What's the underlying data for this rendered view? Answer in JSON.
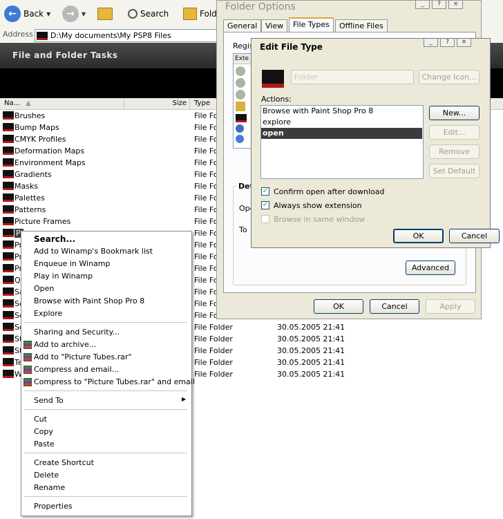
{
  "toolbar": {
    "back_label": "Back",
    "search_label": "Search",
    "folders_label": "Fold"
  },
  "address": {
    "label": "Address",
    "path": "D:\\My documents\\My PSP8 Files"
  },
  "tasks_panel": {
    "title": "File and Folder Tasks"
  },
  "columns": {
    "name": "Na...",
    "size": "Size",
    "type": "Type"
  },
  "files": [
    {
      "name": "Brushes",
      "type": "File Fo",
      "date": ""
    },
    {
      "name": "Bump Maps",
      "type": "File Fo",
      "date": ""
    },
    {
      "name": "CMYK Profiles",
      "type": "File Fo",
      "date": ""
    },
    {
      "name": "Deformation Maps",
      "type": "File Fo",
      "date": ""
    },
    {
      "name": "Environment Maps",
      "type": "File Fo",
      "date": ""
    },
    {
      "name": "Gradients",
      "type": "File Fo",
      "date": ""
    },
    {
      "name": "Masks",
      "type": "File Fo",
      "date": ""
    },
    {
      "name": "Palettes",
      "type": "File Fo",
      "date": ""
    },
    {
      "name": "Patterns",
      "type": "File Fo",
      "date": ""
    },
    {
      "name": "Picture Frames",
      "type": "File Fo",
      "date": ""
    },
    {
      "name": "Pi",
      "type": "File Fo",
      "date": ""
    },
    {
      "name": "Pr",
      "type": "File Fo",
      "date": ""
    },
    {
      "name": "Pr",
      "type": "File Fo",
      "date": ""
    },
    {
      "name": "Pr",
      "type": "File Fo",
      "date": ""
    },
    {
      "name": "Q",
      "type": "File Fo",
      "date": ""
    },
    {
      "name": "Sa",
      "type": "File Fo",
      "date": ""
    },
    {
      "name": "Sc",
      "type": "File Fo",
      "date": ""
    },
    {
      "name": "Sc",
      "type": "File Fo",
      "date": ""
    },
    {
      "name": "Sc",
      "type": "File Folder",
      "date": "30.05.2005 21:41"
    },
    {
      "name": "St",
      "type": "File Folder",
      "date": "30.05.2005 21:41"
    },
    {
      "name": "St",
      "type": "File Folder",
      "date": "30.05.2005 21:41"
    },
    {
      "name": "Te",
      "type": "File Folder",
      "date": "30.05.2005 21:41"
    },
    {
      "name": "W",
      "type": "File Folder",
      "date": "30.05.2005 21:41"
    }
  ],
  "context_menu": {
    "search": "Search...",
    "winamp_bookmark": "Add to Winamp's Bookmark list",
    "enqueue": "Enqueue in Winamp",
    "play": "Play in Winamp",
    "open": "Open",
    "browse_psp": "Browse with Paint Shop Pro 8",
    "explore": "Explore",
    "sharing": "Sharing and Security...",
    "add_archive": "Add to archive...",
    "add_rar": "Add to \"Picture Tubes.rar\"",
    "compress_email": "Compress and email...",
    "compress_rar_email": "Compress to \"Picture Tubes.rar\" and email",
    "send_to": "Send To",
    "cut": "Cut",
    "copy": "Copy",
    "paste": "Paste",
    "create_shortcut": "Create Shortcut",
    "delete": "Delete",
    "rename": "Rename",
    "properties": "Properties"
  },
  "folder_options": {
    "title": "Folder Options",
    "tabs": [
      "General",
      "View",
      "File Types",
      "Offline Files"
    ],
    "registered_label": "Regis",
    "ext_header": "Exte",
    "details_label": "Det",
    "opens_label": "Ope",
    "to_label": "To",
    "advanced": "Advanced",
    "ok": "OK",
    "cancel": "Cancel",
    "apply": "Apply"
  },
  "edit_file_type": {
    "title": "Edit File Type",
    "type_name": "Folder",
    "change_icon": "Change Icon...",
    "actions_label": "Actions:",
    "actions": [
      "Browse with Paint Shop Pro 8",
      "explore",
      "open"
    ],
    "new": "New...",
    "edit": "Edit...",
    "remove": "Remove",
    "set_default": "Set Default",
    "confirm_open": "Confirm open after download",
    "always_show_ext": "Always show extension",
    "browse_same_window": "Browse in same window",
    "ok": "OK",
    "cancel": "Cancel"
  },
  "colors": {
    "selection": "#3c3c3c",
    "folder_red": "#b01818",
    "window_bg": "#ece9d8",
    "tab_accent": "#e0a440"
  }
}
